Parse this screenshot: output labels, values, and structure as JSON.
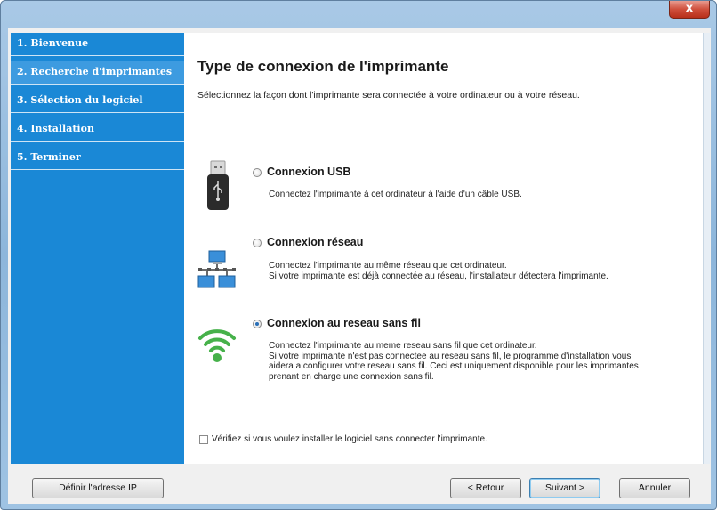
{
  "window": {
    "close_glyph": "x"
  },
  "sidebar": {
    "items": [
      {
        "label": "1. Bienvenue"
      },
      {
        "label": "2. Recherche d'imprimantes"
      },
      {
        "label": "3. Sélection du logiciel"
      },
      {
        "label": "4. Installation"
      },
      {
        "label": "5. Terminer"
      }
    ],
    "active_index": 1
  },
  "main": {
    "title": "Type de connexion de l'imprimante",
    "subtitle": "Sélectionnez la façon dont l'imprimante sera connectée à votre ordinateur ou à votre réseau.",
    "options": [
      {
        "label": "Connexion USB",
        "icon": "usb-icon",
        "selected": false,
        "description": [
          "Connectez l'imprimante à cet ordinateur à l'aide d'un câble USB."
        ]
      },
      {
        "label": "Connexion réseau",
        "icon": "network-icon",
        "selected": false,
        "description": [
          "Connectez l'imprimante au même réseau que cet ordinateur.",
          "Si votre imprimante est déjà connectée au réseau, l'installateur détectera l'imprimante."
        ]
      },
      {
        "label": "Connexion au reseau sans fil",
        "icon": "wifi-icon",
        "selected": true,
        "description": [
          "Connectez l'imprimante au meme reseau sans fil que cet ordinateur.",
          "Si votre imprimante n'est pas connectee au reseau sans fil, le programme d'installation vous",
          "aidera a configurer votre reseau sans fil. Ceci est uniquement disponible pour les imprimantes",
          "prenant en charge une connexion sans fil."
        ]
      }
    ],
    "checkbox": {
      "label": "Vérifiez si vous voulez installer le logiciel sans connecter l'imprimante.",
      "checked": false
    }
  },
  "footer": {
    "set_ip_label": "Définir l'adresse IP",
    "back_label": "< Retour",
    "next_label": "Suivant >",
    "cancel_label": "Annuler"
  },
  "colors": {
    "sidebar_bg": "#1a88d6",
    "sidebar_active": "#3d9be0",
    "radio_selected": "#2a6fb7"
  }
}
